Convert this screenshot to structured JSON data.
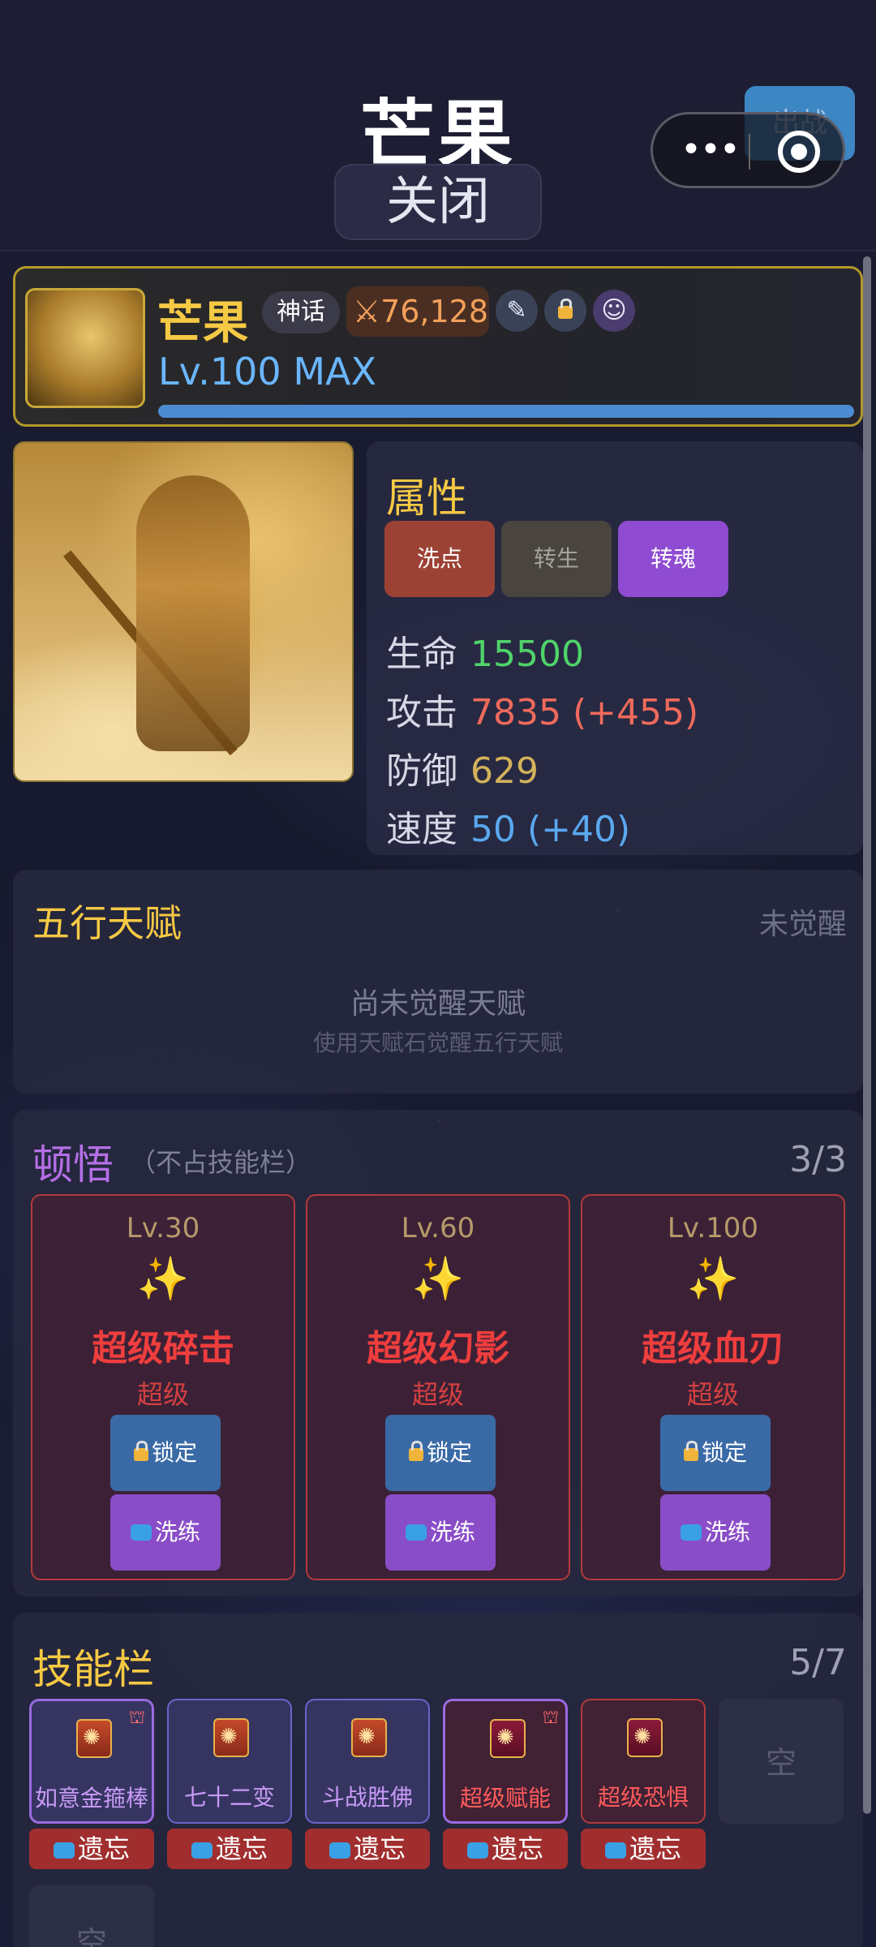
{
  "header": {
    "title": "芒果",
    "close_label": "关闭",
    "battle_label": "出战"
  },
  "hero": {
    "name": "芒果",
    "rarity_tag": "神话",
    "power": "⚔76,128",
    "level_text": "Lv.100 MAX",
    "exp_fraction": 1.0
  },
  "attributes": {
    "title": "属性",
    "buttons": [
      "洗点",
      "转生",
      "转魂"
    ],
    "stats": [
      {
        "key": "生命",
        "value": "15500",
        "color": "#4fd36a"
      },
      {
        "key": "攻击",
        "value": "7835 (+455)",
        "color": "#ef6a5c"
      },
      {
        "key": "防御",
        "value": "629",
        "color": "#d3b25a"
      },
      {
        "key": "速度",
        "value": "50 (+40)",
        "color": "#5aa8ef"
      }
    ]
  },
  "talent": {
    "title": "五行天赋",
    "status": "未觉醒",
    "message": "尚未觉醒天赋",
    "hint": "使用天赋石觉醒五行天赋"
  },
  "enlighten": {
    "title": "顿悟",
    "subtitle": "（不占技能栏）",
    "count": "3/3",
    "cards": [
      {
        "level": "Lv.30",
        "name": "超级碎击",
        "grade": "超级",
        "lock_label": "锁定",
        "wash_label": "洗练"
      },
      {
        "level": "Lv.60",
        "name": "超级幻影",
        "grade": "超级",
        "lock_label": "锁定",
        "wash_label": "洗练"
      },
      {
        "level": "Lv.100",
        "name": "超级血刃",
        "grade": "超级",
        "lock_label": "锁定",
        "wash_label": "洗练"
      }
    ]
  },
  "skills": {
    "title": "技能栏",
    "count": "5/7",
    "slots": [
      {
        "name": "如意金箍棒",
        "type": "normal",
        "forget_label": "遗忘"
      },
      {
        "name": "七十二变",
        "type": "normal",
        "forget_label": "遗忘"
      },
      {
        "name": "斗战胜佛",
        "type": "normal",
        "forget_label": "遗忘"
      },
      {
        "name": "超级赋能",
        "type": "super",
        "forget_label": "遗忘"
      },
      {
        "name": "超级恐惧",
        "type": "super",
        "forget_label": "遗忘"
      }
    ],
    "empty_label": "空"
  }
}
